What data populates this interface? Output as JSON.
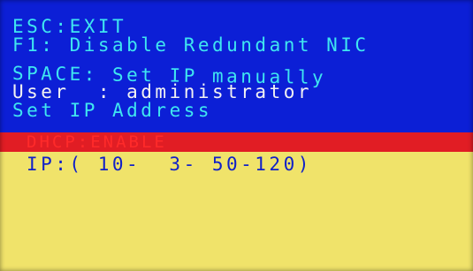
{
  "shortcuts": {
    "esc": "ESC:EXIT",
    "f1": "F1: Disable Redundant NIC",
    "space": "SPACE: Set IP manually"
  },
  "user_line": "User  : administrator",
  "set_ip_label": "Set IP Address",
  "dhcp_status": "DHCP:ENABLE",
  "ip_line": "IP:( 10-  3- 50-120)",
  "colors": {
    "background": "#0c1fd6",
    "shortcut_text": "#3fe6f0",
    "user_text": "#f2f2f2",
    "panel": "#f0e36a",
    "panel_header": "#e11d24",
    "dhcp_text": "#ff2a2a",
    "ip_text": "#1020c8"
  }
}
